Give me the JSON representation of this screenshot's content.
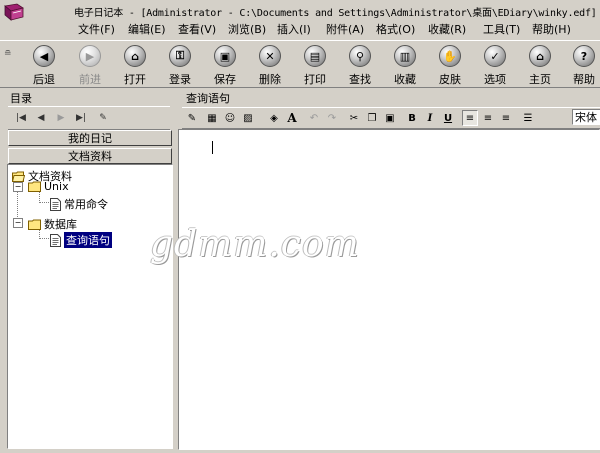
{
  "window": {
    "title": "电子日记本 - [Administrator - C:\\Documents and Settings\\Administrator\\桌面\\EDiary\\winky.edf]"
  },
  "menu": {
    "file": "文件(F)",
    "edit": "编辑(E)",
    "view": "查看(V)",
    "browse": "浏览(B)",
    "insert": "插入(I)",
    "attach": "附件(A)",
    "format": "格式(O)",
    "favorites": "收藏(R)",
    "tools": "工具(T)",
    "help": "帮助(H)"
  },
  "toolbar": {
    "back": "后退",
    "forward": "前进",
    "open": "打开",
    "login": "登录",
    "save": "保存",
    "delete": "删除",
    "print": "打印",
    "find": "查找",
    "favorite": "收藏",
    "skin": "皮肤",
    "options": "选项",
    "home": "主页",
    "help": "帮助"
  },
  "left": {
    "title": "目录",
    "my_diary": "我的日记",
    "documents": "文档资料",
    "tree": {
      "root": "文档资料",
      "unix": "Unix",
      "common_cmds": "常用命令",
      "database": "数据库",
      "query": "查询语句"
    }
  },
  "right": {
    "title": "查询语句",
    "font": "宋体"
  },
  "watermark": "gdmm.com"
}
